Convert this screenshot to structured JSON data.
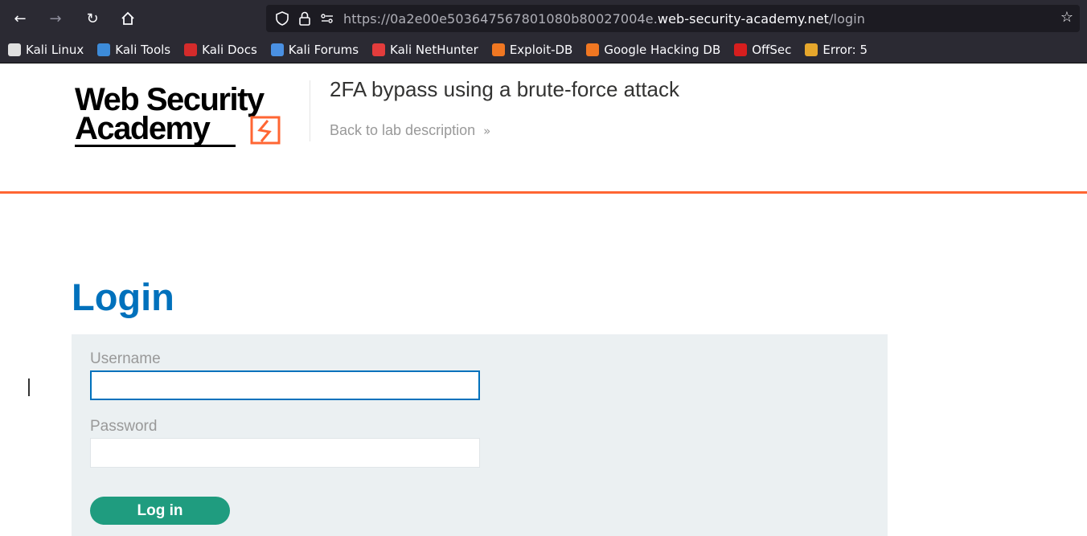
{
  "browser": {
    "url_prefix": "https://0a2e00e503647567801080b80027004e.",
    "url_domain": "web-security-academy.net",
    "url_path": "/login"
  },
  "bookmarks": [
    {
      "label": "Kali Linux",
      "icon": "kali-dragon-icon",
      "color": "#e0e0e0"
    },
    {
      "label": "Kali Tools",
      "icon": "kali-tools-icon",
      "color": "#3d8bd9"
    },
    {
      "label": "Kali Docs",
      "icon": "kali-docs-icon",
      "color": "#d42b2b"
    },
    {
      "label": "Kali Forums",
      "icon": "kali-forums-icon",
      "color": "#4a90e2"
    },
    {
      "label": "Kali NetHunter",
      "icon": "kali-nethunter-icon",
      "color": "#e33c3c"
    },
    {
      "label": "Exploit-DB",
      "icon": "exploit-db-icon",
      "color": "#f07722"
    },
    {
      "label": "Google Hacking DB",
      "icon": "ghdb-icon",
      "color": "#f07722"
    },
    {
      "label": "OffSec",
      "icon": "offsec-icon",
      "color": "#d61e1e"
    },
    {
      "label": "Error: 5",
      "icon": "error-icon",
      "color": "#e6a72c"
    }
  ],
  "header": {
    "logo_line1": "Web Security",
    "logo_line2": "Academy",
    "lab_title": "2FA bypass using a brute-force attack",
    "back_link": "Back to lab description"
  },
  "login": {
    "title": "Login",
    "username_label": "Username",
    "username_value": "",
    "password_label": "Password",
    "password_value": "",
    "submit_label": "Log in"
  },
  "colors": {
    "accent_orange": "#ff6633",
    "title_blue": "#0071bc",
    "button_green": "#1f9c7f"
  }
}
